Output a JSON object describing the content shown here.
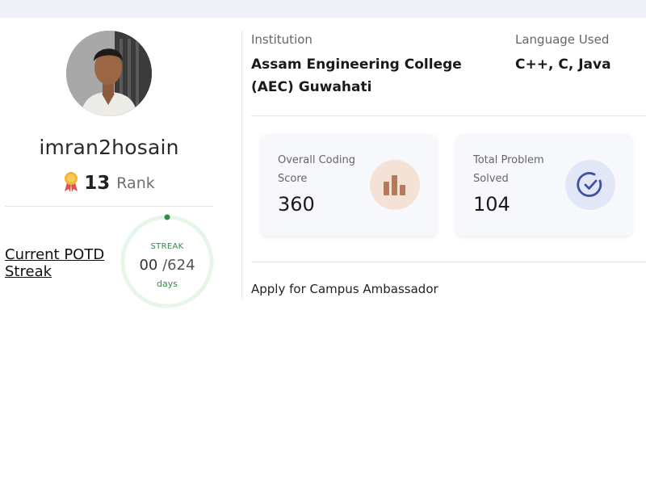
{
  "profile": {
    "username": "imran2hosain",
    "rank_value": "13",
    "rank_label": "Rank"
  },
  "potd": {
    "label": "Current POTD Streak",
    "streak_title": "STREAK",
    "current": "00",
    "total": "/624",
    "unit": "days"
  },
  "info": {
    "institution_label": "Institution",
    "institution_value": "Assam Engineering College (AEC) Guwahati",
    "language_label": "Language Used",
    "language_value": "C++, C, Java"
  },
  "stats": [
    {
      "label": "Overall Coding Score",
      "value": "360",
      "icon": "bar-chart-icon",
      "icon_color": "#b97856"
    },
    {
      "label": "Total Problem Solved",
      "value": "104",
      "icon": "check-circle-icon",
      "icon_color": "#3f51a0"
    }
  ],
  "apply_link": "Apply for Campus Ambassador",
  "colors": {
    "accent_green": "#2f8d46",
    "ring_bg": "#e6f6e9"
  }
}
